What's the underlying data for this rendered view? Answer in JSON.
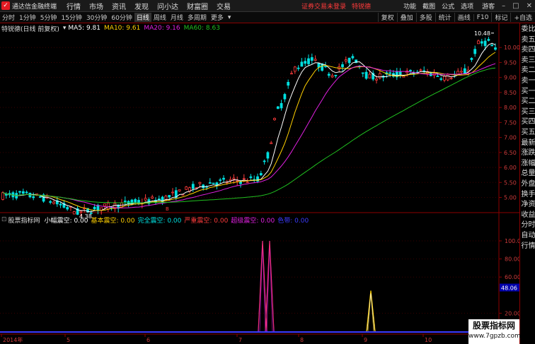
{
  "titlebar": {
    "app_name": "通达信金融终端",
    "menus": [
      "行情",
      "市场",
      "资讯",
      "发现",
      "问小达",
      "财富圈",
      "交易"
    ],
    "warning": "证券交易未登录",
    "stock": "特锐德",
    "right_menus": [
      "功能",
      "截图",
      "公式",
      "选项"
    ],
    "user": "游客"
  },
  "toolbar": {
    "periods": [
      "分时",
      "1分钟",
      "5分钟",
      "15分钟",
      "30分钟",
      "60分钟",
      "日线",
      "周线",
      "月线",
      "多周期",
      "更多"
    ],
    "active": "日线",
    "right_buttons": [
      "复权",
      "叠加",
      "多股",
      "统计",
      "画线",
      "F10",
      "标记",
      "+自选"
    ]
  },
  "main_chart": {
    "label": "特锐德(日线 前复权)",
    "ma": [
      {
        "name": "MA5",
        "value": "9.81",
        "color": "#ffffff"
      },
      {
        "name": "MA10",
        "value": "9.61",
        "color": "#ffd000"
      },
      {
        "name": "MA20",
        "value": "9.16",
        "color": "#e020e0"
      },
      {
        "name": "MA60",
        "value": "8.63",
        "color": "#20c020"
      }
    ],
    "y_ticks": [
      "10.00",
      "9.50",
      "9.00",
      "8.50",
      "8.00",
      "7.50",
      "7.00",
      "6.50",
      "6.00",
      "5.50",
      "5.00"
    ],
    "high_label": "10.48",
    "low_label": "4.38",
    "marker": "B"
  },
  "indicator_chart": {
    "label": "股票指标网",
    "items": [
      {
        "name": "小幅震空",
        "value": "0.00",
        "color": "#ffffff"
      },
      {
        "name": "基本震空",
        "value": "0.00",
        "color": "#ffd000"
      },
      {
        "name": "完全震空",
        "value": "0.00",
        "color": "#00e0e0"
      },
      {
        "name": "严重震空",
        "value": "0.00",
        "color": "#ff3b3b"
      },
      {
        "name": "超级震空",
        "value": "0.00",
        "color": "#e020e0"
      },
      {
        "name": "色带",
        "value": "0.00",
        "color": "#3b3bff"
      }
    ],
    "y_ticks": [
      "100.0",
      "80.00",
      "60.00",
      "20.00"
    ],
    "current": "48.06"
  },
  "x_axis": [
    "2014年",
    "5",
    "6",
    "7",
    "8",
    "9",
    "10"
  ],
  "sidebar": [
    "委比",
    "卖五",
    "卖四",
    "卖三",
    "卖二",
    "卖一",
    "买一",
    "买二",
    "买三",
    "买四",
    "买五",
    "最新",
    "涨跌",
    "涨幅",
    "总量",
    "外盘",
    "换手",
    "净资",
    "收益",
    "分时",
    "自动",
    "行情"
  ],
  "watermark": {
    "title": "股票指标网",
    "url": "www.7gpzb.com"
  }
}
